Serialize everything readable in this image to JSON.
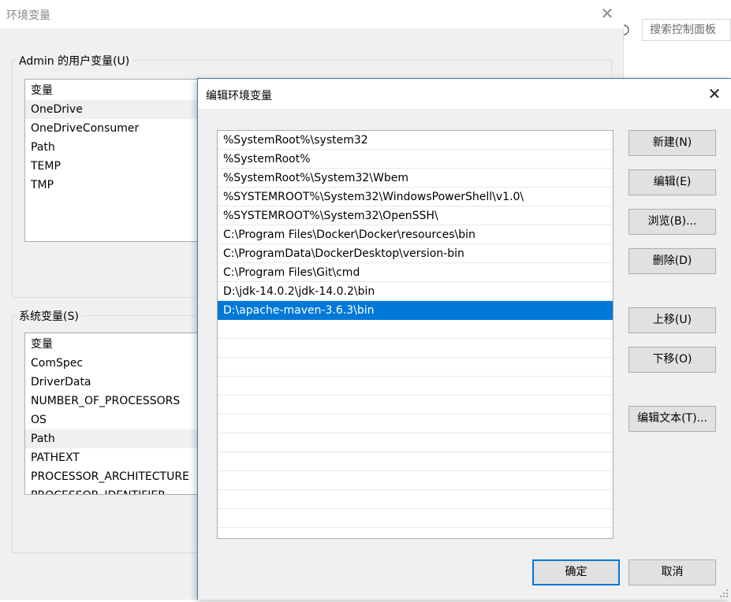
{
  "background_window": {
    "title": "环境变量",
    "user_group_label": "Admin 的用户变量(U)",
    "user_vars_header": "变量",
    "user_vars": [
      "OneDrive",
      "OneDriveConsumer",
      "Path",
      "TEMP",
      "TMP"
    ],
    "system_group_label": "系统变量(S)",
    "system_vars_header": "变量",
    "system_vars": [
      "ComSpec",
      "DriverData",
      "NUMBER_OF_PROCESSORS",
      "OS",
      "Path",
      "PATHEXT",
      "PROCESSOR_ARCHITECTURE",
      "PROCESSOR_IDENTIFIER"
    ]
  },
  "control_panel": {
    "search_placeholder": "搜索控制面板"
  },
  "dialog": {
    "title": "编辑环境变量",
    "paths": [
      "%SystemRoot%\\system32",
      "%SystemRoot%",
      "%SystemRoot%\\System32\\Wbem",
      "%SYSTEMROOT%\\System32\\WindowsPowerShell\\v1.0\\",
      "%SYSTEMROOT%\\System32\\OpenSSH\\",
      "C:\\Program Files\\Docker\\Docker\\resources\\bin",
      "C:\\ProgramData\\DockerDesktop\\version-bin",
      "C:\\Program Files\\Git\\cmd",
      "D:\\jdk-14.0.2\\jdk-14.0.2\\bin",
      "D:\\apache-maven-3.6.3\\bin"
    ],
    "selected_index": 9,
    "buttons": {
      "new": "新建(N)",
      "edit": "编辑(E)",
      "browse": "浏览(B)...",
      "delete": "删除(D)",
      "move_up": "上移(U)",
      "move_down": "下移(O)",
      "edit_text": "编辑文本(T)...",
      "ok": "确定",
      "cancel": "取消"
    }
  },
  "colors": {
    "selection": "#0078d7",
    "window_bg": "#f0f0f0",
    "dialog_border": "#3c7fb1"
  }
}
